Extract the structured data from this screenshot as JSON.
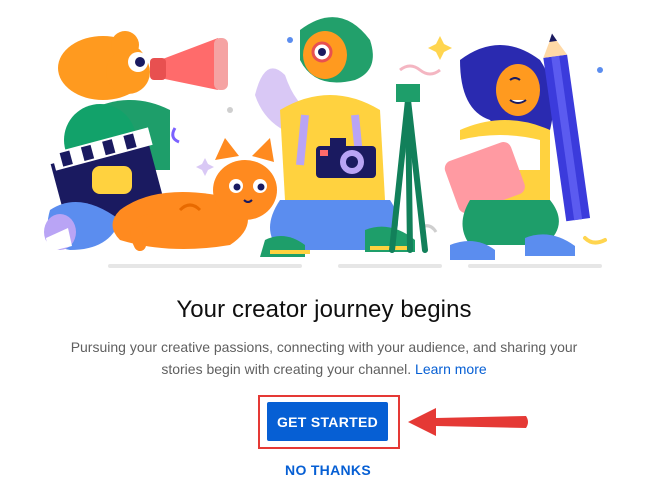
{
  "dialog": {
    "title": "Your creator journey begins",
    "description": "Pursuing your creative passions, connecting with your audience, and sharing your stories begin with creating your channel.",
    "learn_more": "Learn more",
    "primary_button": "GET STARTED",
    "secondary_button": "NO THANKS"
  },
  "colors": {
    "accent": "#065fd4",
    "highlight": "#e53935",
    "title_text": "#0f0f0f",
    "body_text": "#606060"
  },
  "icons": {
    "illustration": "creators-illustration",
    "arrow": "red-arrow-left-icon"
  }
}
